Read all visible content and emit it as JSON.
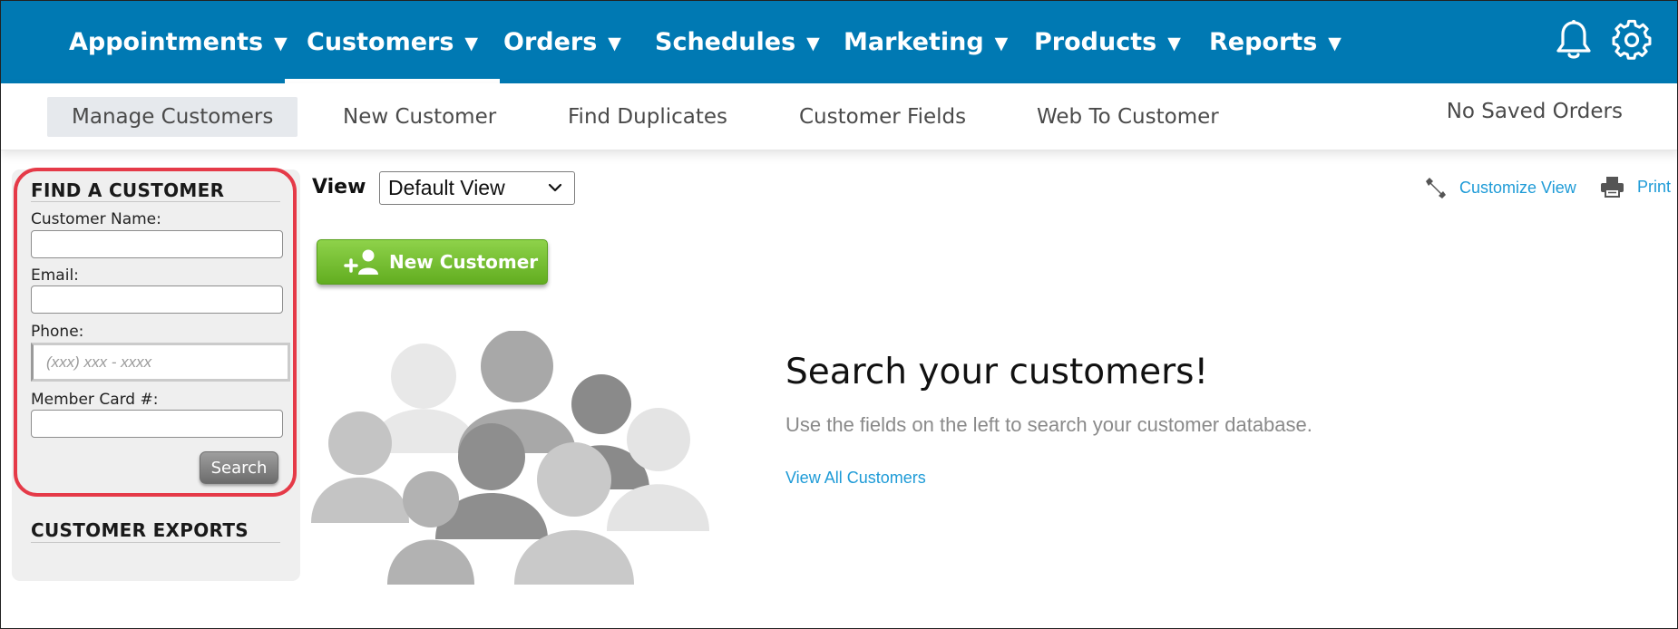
{
  "topnav": {
    "items": [
      {
        "label": "Appointments",
        "caret": "▼"
      },
      {
        "label": "Customers",
        "caret": "▼"
      },
      {
        "label": "Orders",
        "caret": "▼"
      },
      {
        "label": "Schedules",
        "caret": "▼"
      },
      {
        "label": "Marketing",
        "caret": "▼"
      },
      {
        "label": "Products",
        "caret": "▼"
      },
      {
        "label": "Reports",
        "caret": "▼"
      }
    ],
    "active": "Customers",
    "icons": [
      "bell-icon",
      "gear-icon"
    ],
    "background": "#0079b3"
  },
  "subnav": {
    "items": [
      {
        "label": "Manage Customers"
      },
      {
        "label": "New Customer"
      },
      {
        "label": "Find Duplicates"
      },
      {
        "label": "Customer Fields"
      },
      {
        "label": "Web To Customer"
      }
    ],
    "active": "Manage Customers",
    "saved_orders": "No Saved Orders"
  },
  "find_customer": {
    "title": "FIND A CUSTOMER",
    "name_label": "Customer Name:",
    "name_value": "",
    "email_label": "Email:",
    "email_value": "",
    "phone_label": "Phone:",
    "phone_placeholder": "(xxx) xxx - xxxx",
    "card_label": "Member Card #:",
    "card_value": "",
    "search_label": "Search",
    "highlight_color": "#e53a48"
  },
  "exports": {
    "title": "CUSTOMER EXPORTS"
  },
  "main": {
    "view_label": "View",
    "view_selected": "Default View",
    "customize_label": "Customize View",
    "print_label": "Print",
    "new_customer_label": "New Customer",
    "hero_title": "Search your customers!",
    "hero_subtitle": "Use the fields on the left to search your customer database.",
    "view_all_label": "View All Customers",
    "link_color": "#1e9bd7",
    "button_color": "#6cbb2a"
  }
}
